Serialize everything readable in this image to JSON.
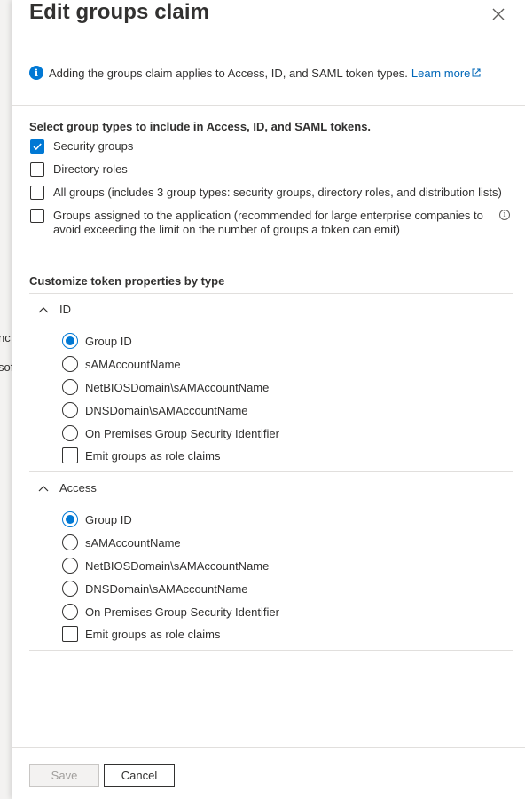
{
  "background": {
    "partial_texts": [
      "nc",
      "sof"
    ]
  },
  "header": {
    "title": "Edit groups claim",
    "close_icon": "close-icon"
  },
  "info": {
    "icon": "info-icon",
    "text": "Adding the groups claim applies to Access, ID, and SAML token types.",
    "link_label": "Learn more"
  },
  "group_types": {
    "label": "Select group types to include in Access, ID, and SAML tokens.",
    "options": [
      {
        "label": "Security groups",
        "checked": true
      },
      {
        "label": "Directory roles",
        "checked": false
      },
      {
        "label": "All groups (includes 3 group types: security groups, directory roles, and distribution lists)",
        "checked": false
      },
      {
        "label": "Groups assigned to the application (recommended for large enterprise companies to avoid exceeding the limit on the number of groups a token can emit)",
        "checked": false
      }
    ]
  },
  "customize": {
    "label": "Customize token properties by type",
    "sections": [
      {
        "title": "ID",
        "expanded": true,
        "options": [
          {
            "label": "Group ID",
            "selected": true
          },
          {
            "label": "sAMAccountName",
            "selected": false
          },
          {
            "label": "NetBIOSDomain\\sAMAccountName",
            "selected": false
          },
          {
            "label": "DNSDomain\\sAMAccountName",
            "selected": false
          },
          {
            "label": "On Premises Group Security Identifier",
            "selected": false
          }
        ],
        "role_claims_label": "Emit groups as role claims",
        "role_claims_checked": false
      },
      {
        "title": "Access",
        "expanded": true,
        "options": [
          {
            "label": "Group ID",
            "selected": true
          },
          {
            "label": "sAMAccountName",
            "selected": false
          },
          {
            "label": "NetBIOSDomain\\sAMAccountName",
            "selected": false
          },
          {
            "label": "DNSDomain\\sAMAccountName",
            "selected": false
          },
          {
            "label": "On Premises Group Security Identifier",
            "selected": false
          }
        ],
        "role_claims_label": "Emit groups as role claims",
        "role_claims_checked": false
      }
    ]
  },
  "footer": {
    "save_label": "Save",
    "save_enabled": false,
    "cancel_label": "Cancel"
  },
  "colors": {
    "accent": "#0078d4",
    "link": "#0067b8",
    "text": "#323130",
    "divider": "#e1dfdd"
  }
}
